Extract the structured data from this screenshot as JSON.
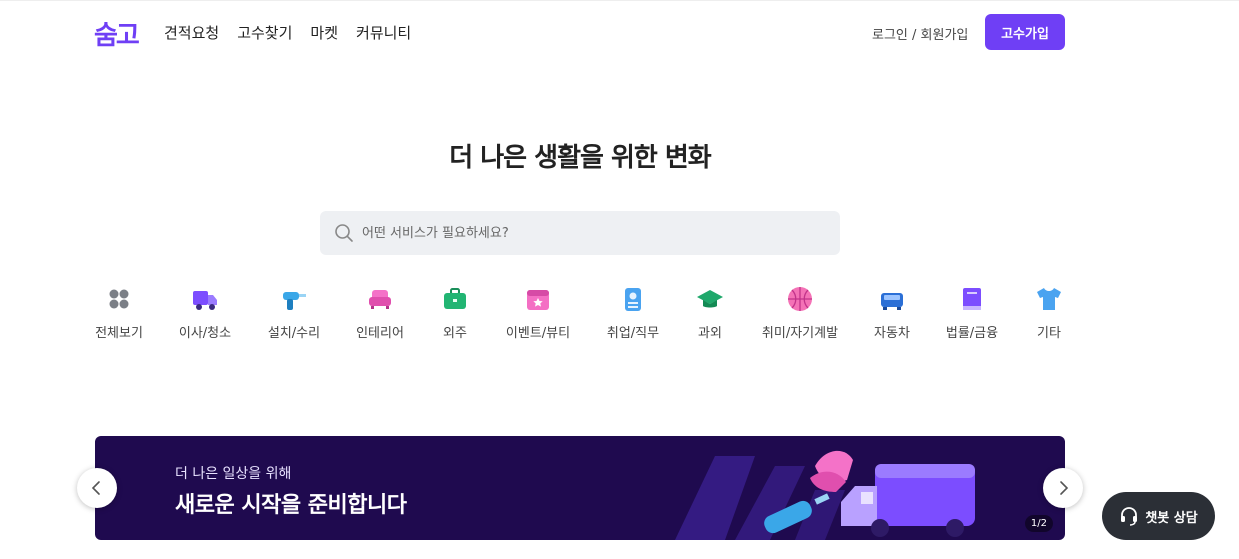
{
  "header": {
    "logo": "숨고",
    "nav": [
      "견적요청",
      "고수찾기",
      "마켓",
      "커뮤니티"
    ],
    "login": "로그인 / 회원가입",
    "pro_join": "고수가입"
  },
  "hero": {
    "title": "더 나은 생활을 위한 변화",
    "search_placeholder": "어떤 서비스가 필요하세요?"
  },
  "categories": [
    {
      "label": "전체보기",
      "icon": "grid-icon"
    },
    {
      "label": "이사/청소",
      "icon": "truck-icon"
    },
    {
      "label": "설치/수리",
      "icon": "drill-icon"
    },
    {
      "label": "인테리어",
      "icon": "sofa-icon"
    },
    {
      "label": "외주",
      "icon": "briefcase-icon"
    },
    {
      "label": "이벤트/뷰티",
      "icon": "calendar-icon"
    },
    {
      "label": "취업/직무",
      "icon": "id-badge-icon"
    },
    {
      "label": "과외",
      "icon": "graduation-cap-icon"
    },
    {
      "label": "취미/자기계발",
      "icon": "basketball-icon"
    },
    {
      "label": "자동차",
      "icon": "car-icon"
    },
    {
      "label": "법률/금융",
      "icon": "book-icon"
    },
    {
      "label": "기타",
      "icon": "shirt-icon"
    }
  ],
  "banner": {
    "subtitle": "더 나은 일상을 위해",
    "title": "새로운 시작을 준비합니다",
    "page": "1/2"
  },
  "chatbot": {
    "label": "챗봇 상담"
  },
  "colors": {
    "brand": "#6f3ff5",
    "banner_bg": "#1f0a4f",
    "chatbot_bg": "#2b2f36"
  }
}
